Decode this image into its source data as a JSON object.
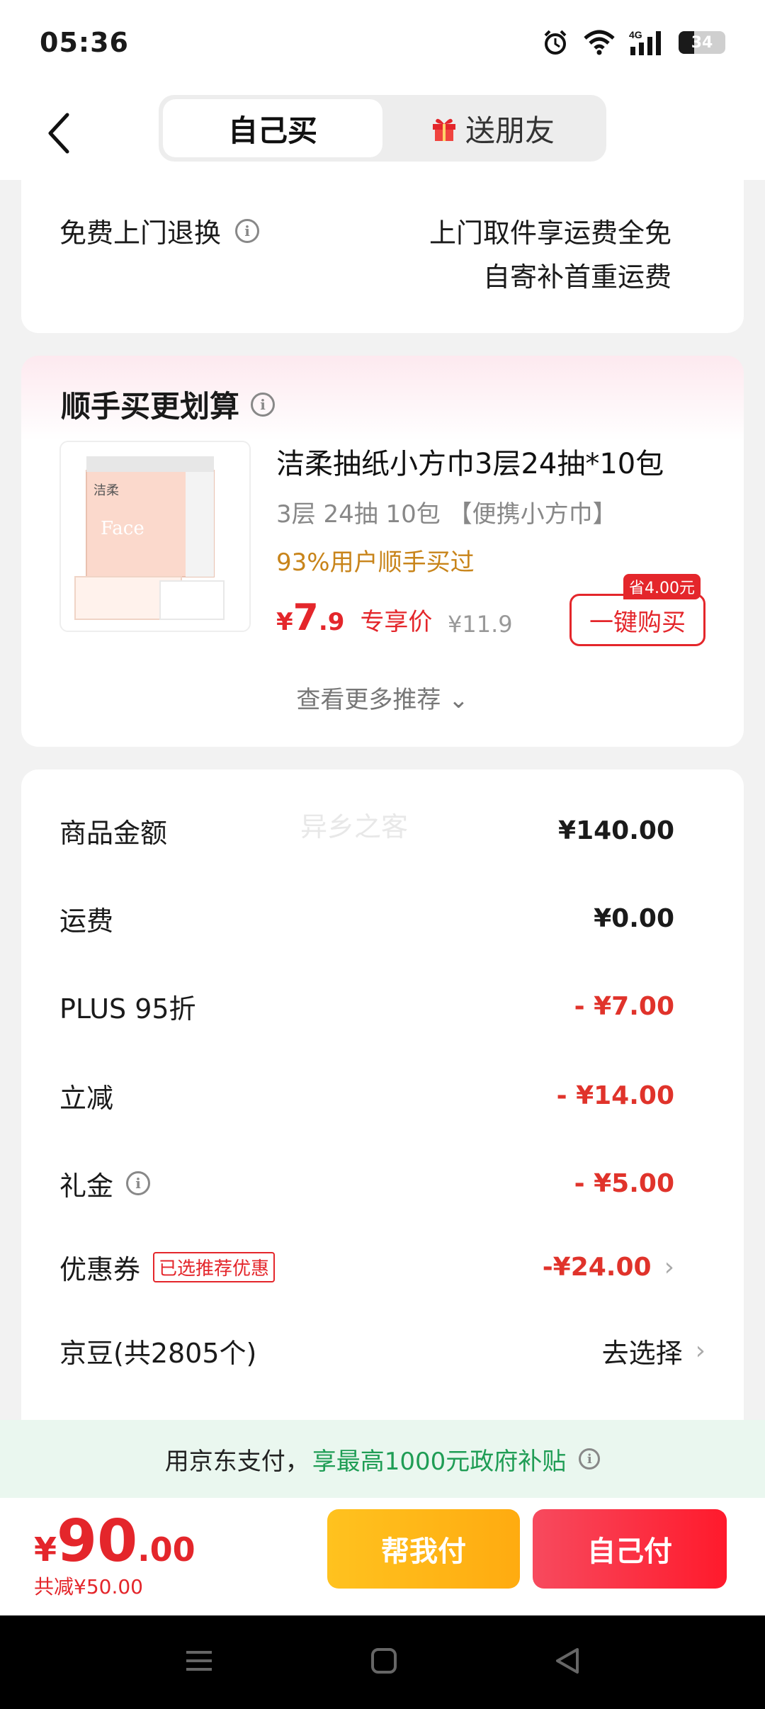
{
  "status_bar": {
    "time": "05:36",
    "network": "4G",
    "battery": "34"
  },
  "nav": {
    "tabs": [
      {
        "label": "自己买",
        "active": true
      },
      {
        "label": "送朋友",
        "active": false
      }
    ]
  },
  "return_service": {
    "label": "免费上门退换",
    "line1": "上门取件享运费全免",
    "line2": "自寄补首重运费"
  },
  "recommend": {
    "title": "顺手买更划算",
    "product": {
      "name": "洁柔抽纸小方巾3层24抽*10包",
      "spec": "3层 24抽 10包 【便携小方巾】",
      "bought_text": "93%用户顺手买过",
      "price_symbol": "¥",
      "price_int": "7",
      "price_dec": ".9",
      "price_tag": "专享价",
      "original_price": "¥11.9",
      "save_badge": "省4.00元",
      "buy_button": "一键购买",
      "image_text": "Face",
      "brand_text": "洁柔"
    },
    "more": "查看更多推荐 ⌄"
  },
  "fees": {
    "watermark": "异乡之客",
    "rows": [
      {
        "label": "商品金额",
        "value": "¥140.00"
      },
      {
        "label": "运费",
        "value": "¥0.00"
      },
      {
        "label": "PLUS 95折",
        "value": "- ¥7.00"
      },
      {
        "label": "立减",
        "value": "- ¥14.00"
      },
      {
        "label": "礼金",
        "value": "- ¥5.00"
      },
      {
        "label": "优惠券",
        "tag": "已选推荐优惠",
        "value": "-¥24.00"
      },
      {
        "label": "京豆(共2805个)",
        "value": "去选择"
      }
    ]
  },
  "pay_banner": {
    "prefix": "用京东支付，",
    "highlight": "享最高1000元政府补贴"
  },
  "bottom": {
    "yen": "¥",
    "total_int": "90",
    "total_dec": ".00",
    "saved": "共减¥50.00",
    "help_pay": "帮我付",
    "self_pay": "自己付"
  },
  "colors": {
    "accent_red": "#e4262b",
    "gold": "#c8841a",
    "green": "#1f9d55"
  }
}
